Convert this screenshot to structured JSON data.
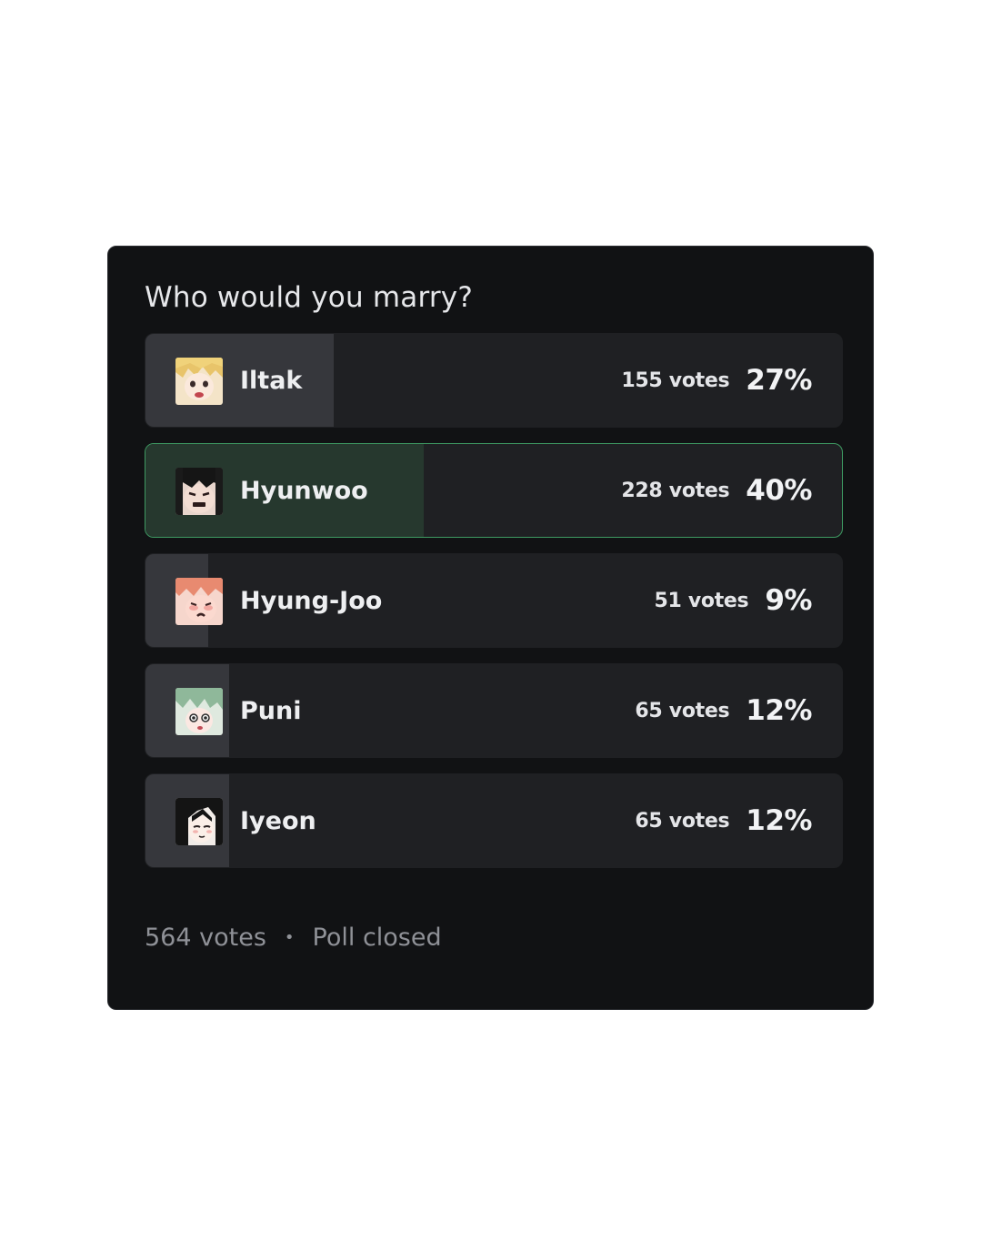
{
  "poll": {
    "question": "Who would you marry?",
    "answers": [
      {
        "label": "Iltak",
        "votes": "155 votes",
        "percent": "27%",
        "fraction": 0.27,
        "selected": false,
        "avatar": "blond-character-avatar"
      },
      {
        "label": "Hyunwoo",
        "votes": "228 votes",
        "percent": "40%",
        "fraction": 0.4,
        "selected": true,
        "avatar": "dark-hair-character-avatar"
      },
      {
        "label": "Hyung-Joo",
        "votes": "51 votes",
        "percent": "9%",
        "fraction": 0.09,
        "selected": false,
        "avatar": "red-hair-character-avatar"
      },
      {
        "label": "Puni",
        "votes": "65 votes",
        "percent": "12%",
        "fraction": 0.12,
        "selected": false,
        "avatar": "green-hair-character-avatar"
      },
      {
        "label": "Iyeon",
        "votes": "65 votes",
        "percent": "12%",
        "fraction": 0.12,
        "selected": false,
        "avatar": "black-hair-character-avatar"
      }
    ],
    "footer": {
      "total": "564 votes",
      "separator": "•",
      "status": "Poll closed"
    }
  },
  "colors": {
    "card_background": "#111214",
    "answer_background": "#1f2023",
    "fill": "#36373c",
    "selected_fill": "#26382e",
    "selected_border": "#3e9a62"
  }
}
